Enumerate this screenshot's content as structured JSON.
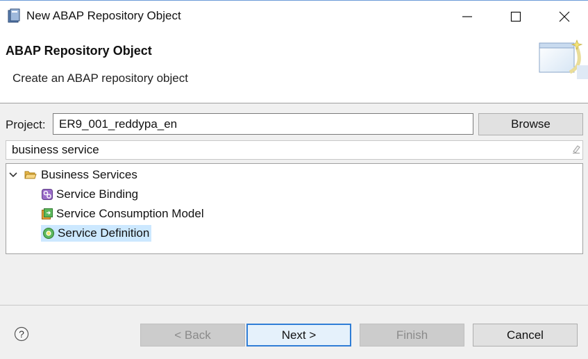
{
  "window": {
    "title": "New ABAP Repository Object",
    "controls": [
      "minimize-icon",
      "maximize-icon",
      "close-icon"
    ]
  },
  "banner": {
    "title": "ABAP Repository Object",
    "description": "Create an ABAP repository object",
    "image": "wizard-banner-icon"
  },
  "project": {
    "label": "Project:",
    "value": "ER9_001_reddypa_en",
    "browse_label": "Browse"
  },
  "filter": {
    "value": "business service",
    "clear_icon": "eraser-icon"
  },
  "tree": {
    "folder": {
      "label": "Business Services",
      "expanded": true,
      "icon": "folder-open-icon"
    },
    "items": [
      {
        "label": "Service Binding",
        "icon": "service-binding-icon",
        "selected": false
      },
      {
        "label": "Service Consumption Model",
        "icon": "service-consumption-model-icon",
        "selected": false
      },
      {
        "label": "Service Definition",
        "icon": "service-definition-icon",
        "selected": true
      }
    ]
  },
  "footer": {
    "help_icon": "help-icon",
    "back_label": "< Back",
    "next_label": "Next >",
    "finish_label": "Finish",
    "cancel_label": "Cancel",
    "back_enabled": false,
    "finish_enabled": false
  },
  "colors": {
    "selection": "#cce8ff",
    "default_button_border": "#2f7dd6",
    "folder": "#e8b84a"
  }
}
